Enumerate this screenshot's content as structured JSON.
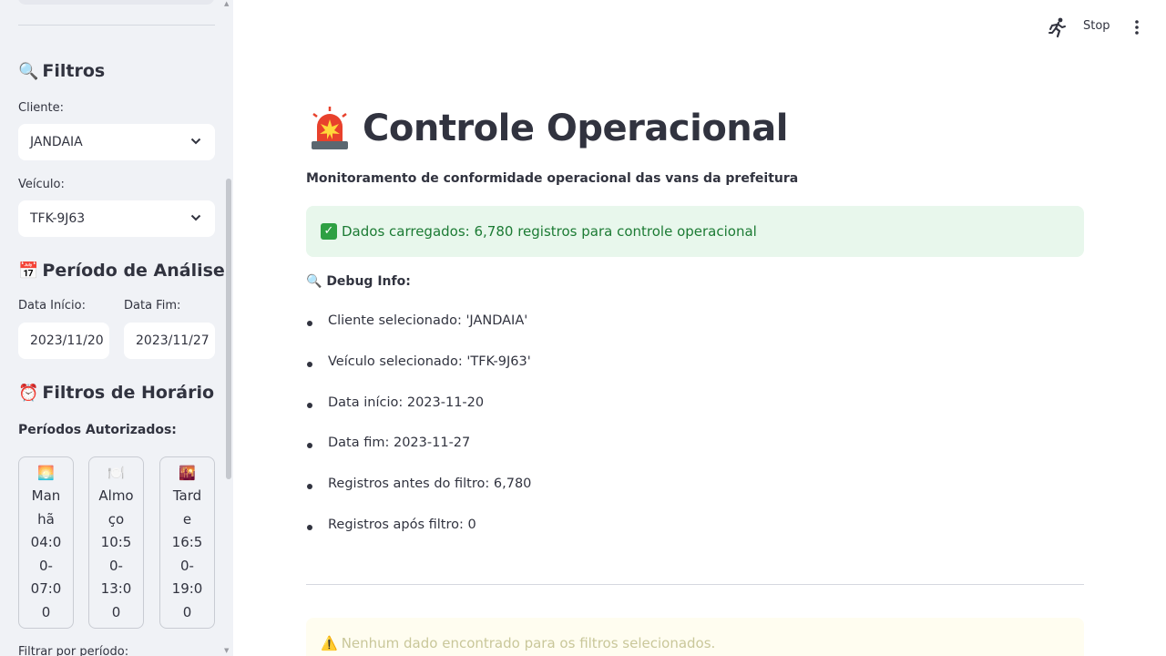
{
  "sidebar": {
    "filters_title": "Filtros",
    "cliente": {
      "label": "Cliente:",
      "value": "JANDAIA"
    },
    "veiculo": {
      "label": "Veículo:",
      "value": "TFK-9J63"
    },
    "periodo_title": "Período de Análise",
    "data_inicio": {
      "label": "Data Início:",
      "value": "2023/11/20"
    },
    "data_fim": {
      "label": "Data Fim:",
      "value": "2023/11/27"
    },
    "horario_title": "Filtros de Horário",
    "periodos_label": "Períodos Autorizados:",
    "periods": [
      {
        "icon": "sunrise-icon",
        "emoji": "🌅",
        "lines": [
          "Man",
          "hã",
          "04:0",
          "0-",
          "07:0",
          "0"
        ]
      },
      {
        "icon": "plate-icon",
        "emoji": "🍽️",
        "lines": [
          "Almo",
          "ço",
          "10:5",
          "0-",
          "13:0",
          "0"
        ]
      },
      {
        "icon": "sunset-icon",
        "emoji": "🌇",
        "lines": [
          "Tard",
          "e",
          "16:5",
          "0-",
          "19:0",
          "0"
        ]
      }
    ],
    "filtrar_label": "Filtrar por período:"
  },
  "header": {
    "stop_label": "Stop"
  },
  "main": {
    "title": "Controle Operacional",
    "subtitle": "Monitoramento de conformidade operacional das vans da prefeitura",
    "success_msg": "Dados carregados: 6,780 registros para controle operacional",
    "debug_title": "Debug Info:",
    "debug_items": [
      "Cliente selecionado: 'JANDAIA'",
      "Veículo selecionado: 'TFK-9J63'",
      "Data início: 2023-11-20",
      "Data fim: 2023-11-27",
      "Registros antes do filtro: 6,780",
      "Registros após filtro: 0"
    ],
    "warning_msg": "Nenhum dado encontrado para os filtros selecionados."
  },
  "colors": {
    "sidebar_bg": "#f0f2f6",
    "success_bg": "#e8f7ec",
    "success_text": "#1c7b34",
    "warning_bg": "#fffdf0"
  }
}
